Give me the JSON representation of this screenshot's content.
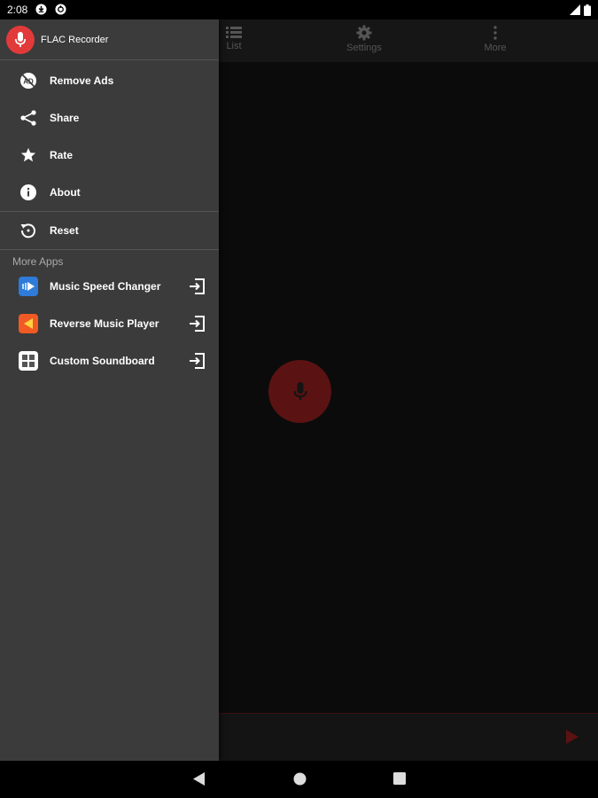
{
  "status_bar": {
    "time": "2:08"
  },
  "toolbar": {
    "list_label": "List",
    "settings_label": "Settings",
    "more_label": "More"
  },
  "drawer": {
    "app_name": "FLAC Recorder",
    "items": [
      {
        "label": "Remove Ads",
        "icon": "no-ads-icon"
      },
      {
        "label": "Share",
        "icon": "share-icon"
      },
      {
        "label": "Rate",
        "icon": "star-icon"
      },
      {
        "label": "About",
        "icon": "info-icon"
      },
      {
        "label": "Reset",
        "icon": "reset-icon"
      }
    ],
    "more_apps_title": "More Apps",
    "more_apps": [
      {
        "label": "Music Speed Changer",
        "icon": "speed-changer-app-icon",
        "color": "#2f7bd9"
      },
      {
        "label": "Reverse Music Player",
        "icon": "reverse-player-app-icon",
        "color": "#f15a24"
      },
      {
        "label": "Custom Soundboard",
        "icon": "soundboard-app-icon",
        "color": "#ffffff"
      }
    ]
  },
  "colors": {
    "accent": "#e23a3a",
    "drawer_bg": "#3b3b3b",
    "record_button": "#5a1212"
  }
}
